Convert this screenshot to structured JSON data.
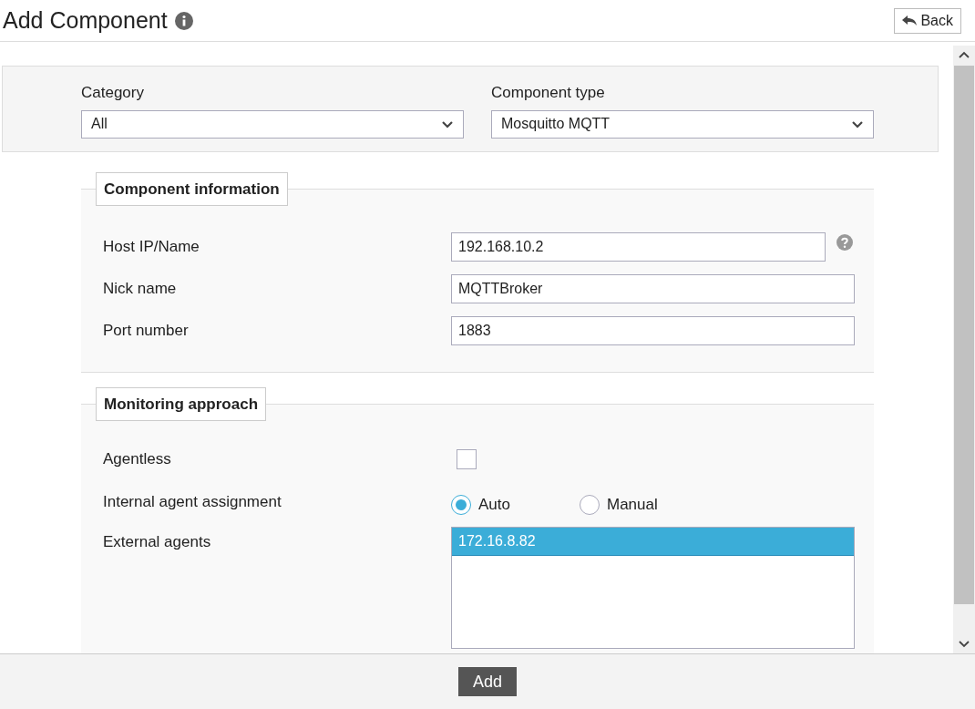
{
  "title": "Add Component",
  "back_button": "Back",
  "filters": [
    {
      "label": "Category",
      "value": "All"
    },
    {
      "label": "Component type",
      "value": "Mosquitto MQTT"
    }
  ],
  "component_information": {
    "legend": "Component information",
    "fields": [
      {
        "label": "Host IP/Name",
        "value": "192.168.10.2",
        "help": true
      },
      {
        "label": "Nick name",
        "value": "MQTTBroker",
        "help": false
      },
      {
        "label": "Port number",
        "value": "1883",
        "help": false
      }
    ]
  },
  "monitoring_approach": {
    "legend": "Monitoring approach",
    "agentless": {
      "label": "Agentless",
      "checked": false
    },
    "internal_agent_assignment": {
      "label": "Internal agent assignment",
      "options": [
        {
          "label": "Auto",
          "selected": true
        },
        {
          "label": "Manual",
          "selected": false
        }
      ]
    },
    "external_agents": {
      "label": "External agents",
      "items": [
        {
          "label": "172.16.8.82",
          "selected": true
        }
      ]
    }
  },
  "add_button": "Add"
}
